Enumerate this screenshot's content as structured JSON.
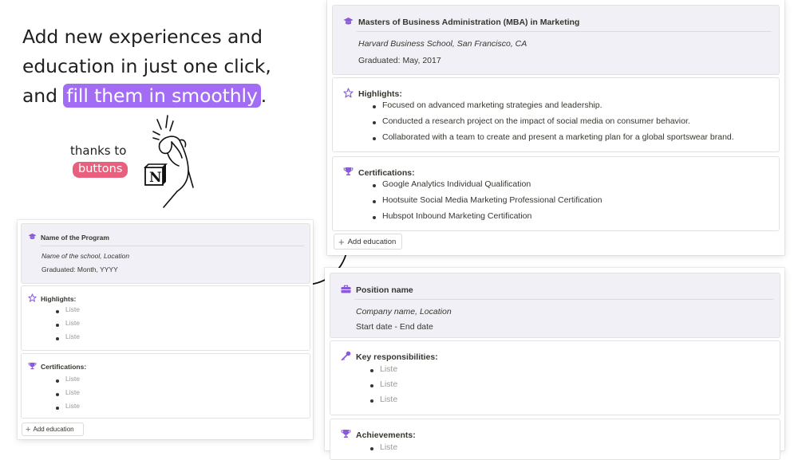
{
  "headline": {
    "line1": "Add new experiences and",
    "line2": "education in just one click,",
    "line3_pre": "and ",
    "line3_hl": "fill them in smoothly",
    "line3_post": "."
  },
  "thanks": {
    "label": "thanks to",
    "pill": "buttons"
  },
  "education_filled": {
    "title": "Masters of Business Administration (MBA) in Marketing",
    "school": "Harvard Business School, San Francisco, CA",
    "graduated": "Graduated: May, 2017",
    "highlights_label": "Highlights:",
    "highlights": [
      "Focused on advanced marketing strategies and leadership.",
      "Conducted a research project on the impact of social media on consumer behavior.",
      "Collaborated with a team to create and present a marketing plan for a global sportswear brand."
    ],
    "certifications_label": "Certifications:",
    "certifications": [
      "Google Analytics Individual Qualification",
      "Hootsuite Social Media Marketing Professional Certification",
      "Hubspot Inbound Marketing Certification"
    ],
    "add_button": "Add education"
  },
  "education_template": {
    "title": "Name of the Program",
    "school": "Name of the school, Location",
    "graduated": "Graduated: Month, YYYY",
    "highlights_label": "Highlights:",
    "highlights": [
      "Liste",
      "Liste",
      "Liste"
    ],
    "certifications_label": "Certifications:",
    "certifications": [
      "Liste",
      "Liste",
      "Liste"
    ],
    "add_button": "Add education"
  },
  "experience_template": {
    "title": "Position name",
    "company": "Company name, Location",
    "dates": "Start date - End date",
    "responsibilities_label": "Key responsibilities:",
    "responsibilities": [
      "Liste",
      "Liste",
      "Liste"
    ],
    "achievements_label": "Achievements:",
    "achievements": [
      "Liste"
    ]
  },
  "colors": {
    "accent": "#a36cf5",
    "pill": "#e8607e",
    "icon": "#8a5bd8",
    "header_bg": "#f2f0f7"
  },
  "icons": {
    "education": "graduation-cap-icon",
    "highlights": "star-outline-icon",
    "certifications": "trophy-icon",
    "position": "briefcase-icon",
    "responsibilities": "key-icon",
    "add": "plus-icon"
  }
}
